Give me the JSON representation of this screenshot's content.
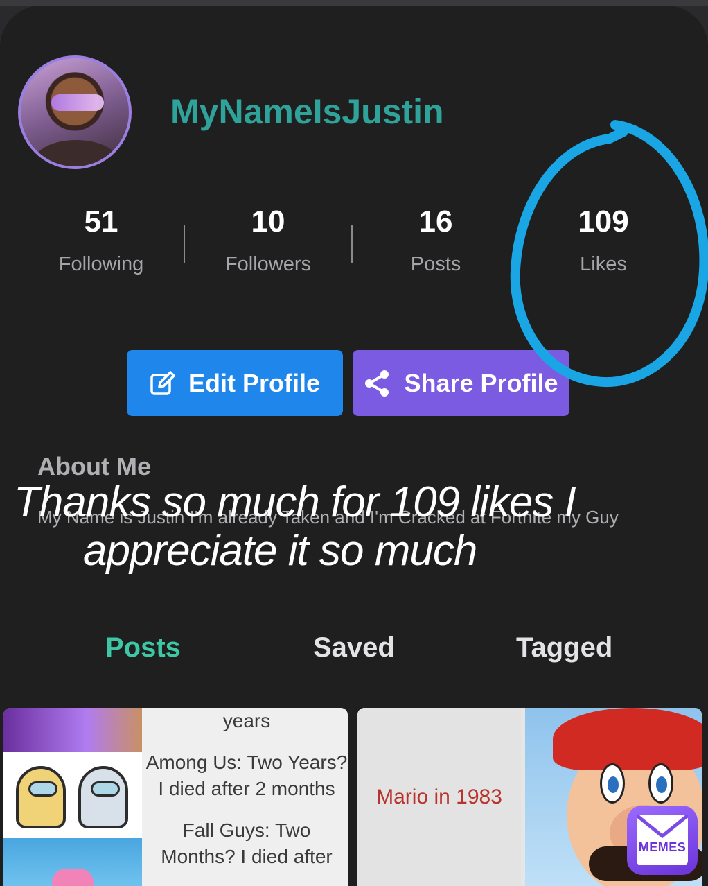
{
  "profile": {
    "username": "MyNameIsJustin"
  },
  "stats": [
    {
      "value": "51",
      "label": "Following"
    },
    {
      "value": "10",
      "label": "Followers"
    },
    {
      "value": "16",
      "label": "Posts"
    },
    {
      "value": "109",
      "label": "Likes"
    }
  ],
  "buttons": {
    "edit": "Edit Profile",
    "share": "Share Profile"
  },
  "about": {
    "title": "About Me",
    "text": "My Name is Justin I'm already Taken and I'm Cracked at Fortnite my Guy"
  },
  "overlay": {
    "line1": "Thanks so much for 109 likes I",
    "line2": "appreciate it so much"
  },
  "tabs": [
    "Posts",
    "Saved",
    "Tagged"
  ],
  "posts": {
    "post1": {
      "text1": "years",
      "text2": "Among Us: Two Years? I died after 2 months",
      "text3": "Fall Guys: Two Months? I died after"
    },
    "post2": {
      "caption": "Mario in 1983"
    }
  },
  "badge": {
    "label": "MEMES"
  },
  "colors": {
    "username": "#2fa29a",
    "edit_button": "#1f86ec",
    "share_button": "#7c5be3",
    "active_tab": "#3ec7a5",
    "annotation_circle": "#1aa6e4"
  }
}
